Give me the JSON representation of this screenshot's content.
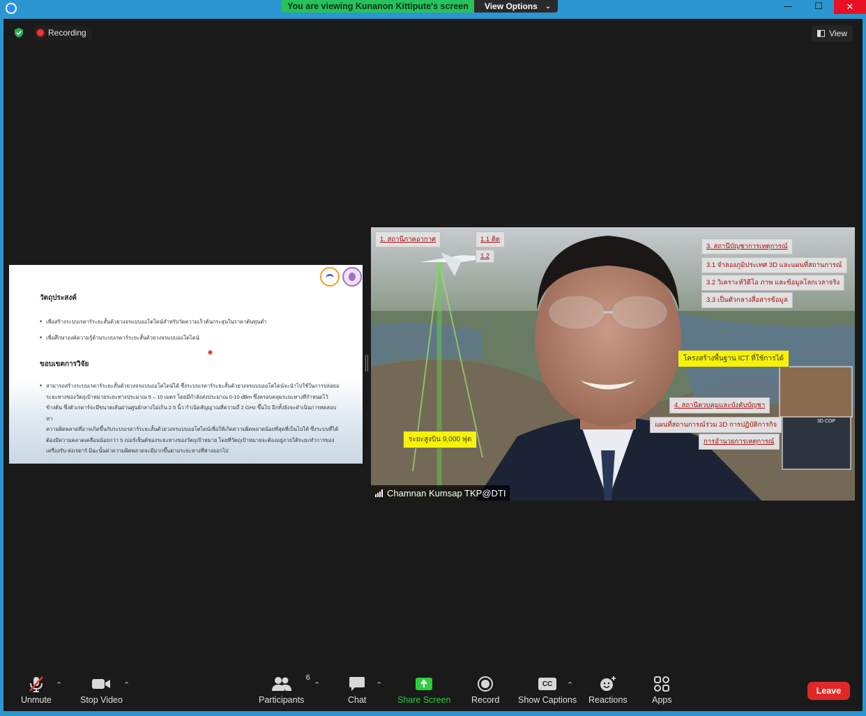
{
  "banner": {
    "viewing_text": "You are viewing Kunanon Kittipute's screen",
    "view_options_label": "View Options"
  },
  "window": {
    "minimize": "—",
    "maximize": "☐",
    "close": "✕"
  },
  "top_bar": {
    "recording_label": "Recording",
    "view_label": "View"
  },
  "slide": {
    "heading1": "วัตถุประสงค์",
    "bullets1": [
      "เพื่อสร้างระบบเรดาร์ระยะสั้นด้วยวงจรแบบออโตไดน์สำหรับวัดความเร็วต้นกระสุนในราคาต้นทุนต่ำ",
      "เพื่อศึกษาองค์ความรู้ด้านระบบเรดาร์ระยะสั้นด้วยวงจรแบบออโตไดน์"
    ],
    "heading2": "ขอบเขตการวิจัย",
    "paragraph_lines": [
      "สามารถสร้างระบบเรดาร์ระยะสั้นด้วยวงจรแบบออโตไดน์ได้     ซึ่งระบบเรดาร์ระยะสั้นด้วยวงจรแบบออโตไดน์จะนำไปใช้ในการปล่อยอ",
      "ระยะทางของวัตถุเป้าหมายระยะทางประมาณ  5  –  10  เมตร  โดยมีกำลังส่งประมาณ  0-10  dBm  ซึ่งครอบคลุมระยะทางที่กำหนดไว้",
      "ข้างต้น  ซึ่งตัวเรดาร์จะมีขนาดเส้นผ่านศูนย์กลางไม่เกิน  2.5  นิ้ว  กำเนิดสัญญาณที่ความถี่  2  GHz  ขึ้นไป  อีกทั้งยังจะดำเนินการทดสอบหา",
      "ความผิดพลาดที่อาจเกิดขึ้นกับระบบเรดาร์ระยะสั้นด้วยวงจรแบบออโตไดน์เพื่อให้เกิดความผิดพลาดน้อยที่สุดที่เป็นไปได้     ซึ่งระบบที่ได้",
      "ต้องมีความคลาดเคลื่อนน้อยกว่า   5   เปอร์เซ็นต์ของระยะทางของวัตถุเป้าหมาย   โดยที่วัตถุเป้าหมายจะต้องอยู่ภายใต้ระยะทำการของ",
      "เครื่องรับ-ส่งเรดาร์  มิฉะนั้นค่าความผิดพลาดจะมีมากขึ้นตามระยะทางที่ห่างออกไป"
    ]
  },
  "speaker": {
    "name": "Chamnan Kumsap TKP@DTI",
    "overlay_labels": [
      "1. สถานีภาคอากาศ",
      "1.1 ติด",
      "1.2",
      "3. สถานีบัญชาการเหตุการณ์",
      "3.1 จำลองภูมิประเทศ 3D และแผนที่สถานการณ์",
      "3.2 วิเคราะห์วิดีโอ ภาพ และข้อมูลโลกเวลาจริง",
      "3.3 เป็นตัวกลางสื่อสารข้อมูล",
      "4. สถานีควบคุมและบังคับบัญชา",
      "แผนที่สถานการณ์ร่วม 3D การปฏิบัติการกิจ",
      "การอำนวยการเหตุการณ์"
    ],
    "yellow_labels": [
      "โครงสร้างพื้นฐาน ICT ที่ใช้การได้",
      "ระยะสูงบิน 9,000 ฟุต"
    ],
    "inset_label": "3D COP"
  },
  "toolbar": {
    "unmute": "Unmute",
    "stop_video": "Stop Video",
    "participants": "Participants",
    "participants_count": "6",
    "chat": "Chat",
    "share_screen": "Share Screen",
    "record": "Record",
    "show_captions": "Show Captions",
    "reactions": "Reactions",
    "apps": "Apps",
    "leave": "Leave",
    "cc_glyph": "CC"
  },
  "colors": {
    "frame": "#2b96d1",
    "banner_green": "#26c25a",
    "share_green": "#2ecc40",
    "leave_red": "#e02828"
  }
}
